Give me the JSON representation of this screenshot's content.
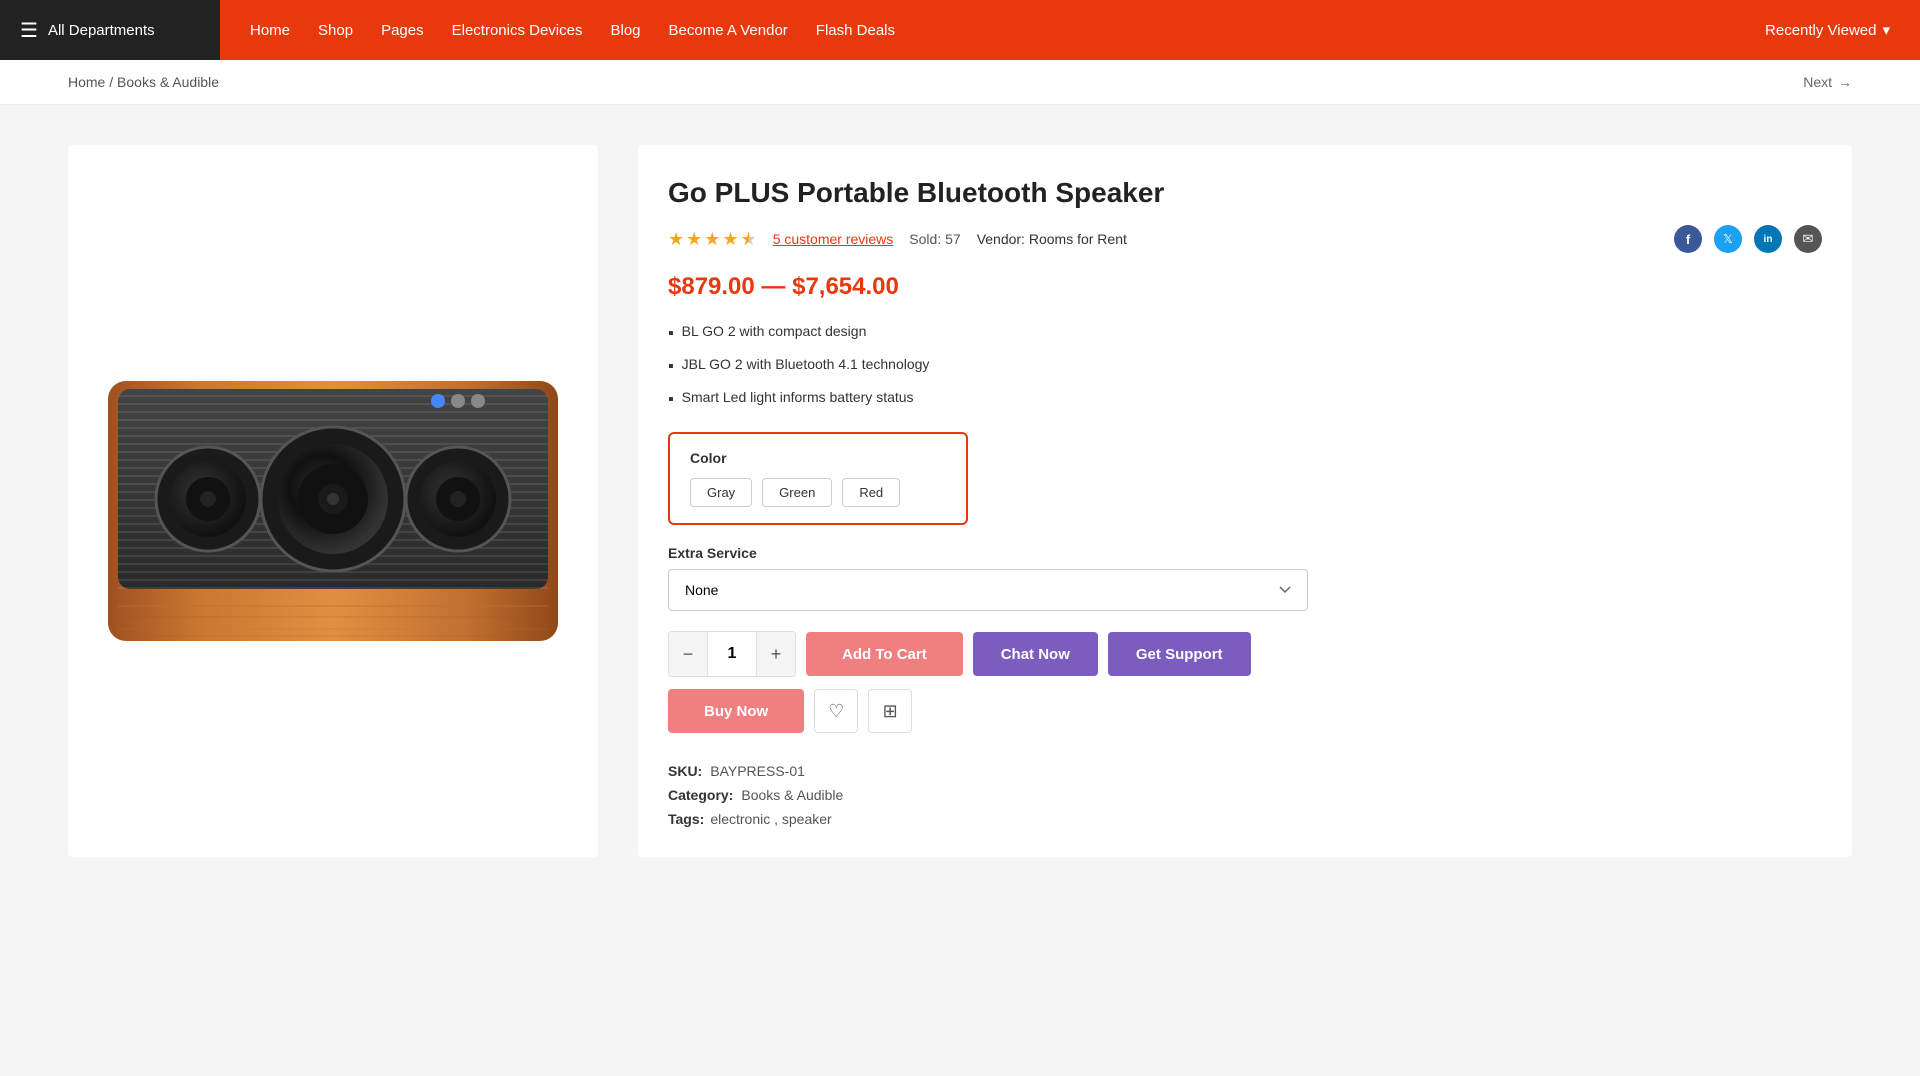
{
  "header": {
    "all_departments": "All Departments",
    "nav": {
      "home": "Home",
      "shop": "Shop",
      "pages": "Pages",
      "electronics": "Electronics Devices",
      "blog": "Blog",
      "vendor": "Become A Vendor",
      "flash_deals": "Flash Deals",
      "recently_viewed": "Recently Viewed"
    }
  },
  "breadcrumb": {
    "home": "Home",
    "separator": "/",
    "current": "Books & Audible"
  },
  "next_label": "Next",
  "product": {
    "title": "Go PLUS Portable Bluetooth Speaker",
    "reviews_count": "5 customer reviews",
    "sold_label": "Sold:",
    "sold_count": "57",
    "vendor_label": "Vendor:",
    "vendor_name": "Rooms for Rent",
    "price_range": "$879.00 — $7,654.00",
    "features": [
      "BL GO 2 with compact design",
      "JBL GO 2 with Bluetooth 4.1 technology",
      "Smart Led light informs battery status"
    ],
    "color_label": "Color",
    "color_options": [
      "Gray",
      "Green",
      "Red"
    ],
    "extra_service_label": "Extra Service",
    "extra_service_default": "None",
    "qty_default": "1",
    "add_to_cart": "Add To Cart",
    "chat_now": "Chat Now",
    "get_support": "Get Support",
    "buy_now": "Buy Now",
    "sku_label": "SKU:",
    "sku_value": "BAYPRESS-01",
    "category_label": "Category:",
    "category_value": "Books & Audible",
    "tags_label": "Tags:",
    "tags_value": "electronic , speaker"
  },
  "icons": {
    "hamburger": "☰",
    "arrow_right": "→",
    "chevron_down": "▾",
    "star_full": "★",
    "star_half": "★",
    "facebook": "f",
    "twitter": "t",
    "linkedin": "in",
    "email": "✉",
    "heart": "♡",
    "compare": "⊞",
    "minus": "−",
    "plus": "+"
  }
}
